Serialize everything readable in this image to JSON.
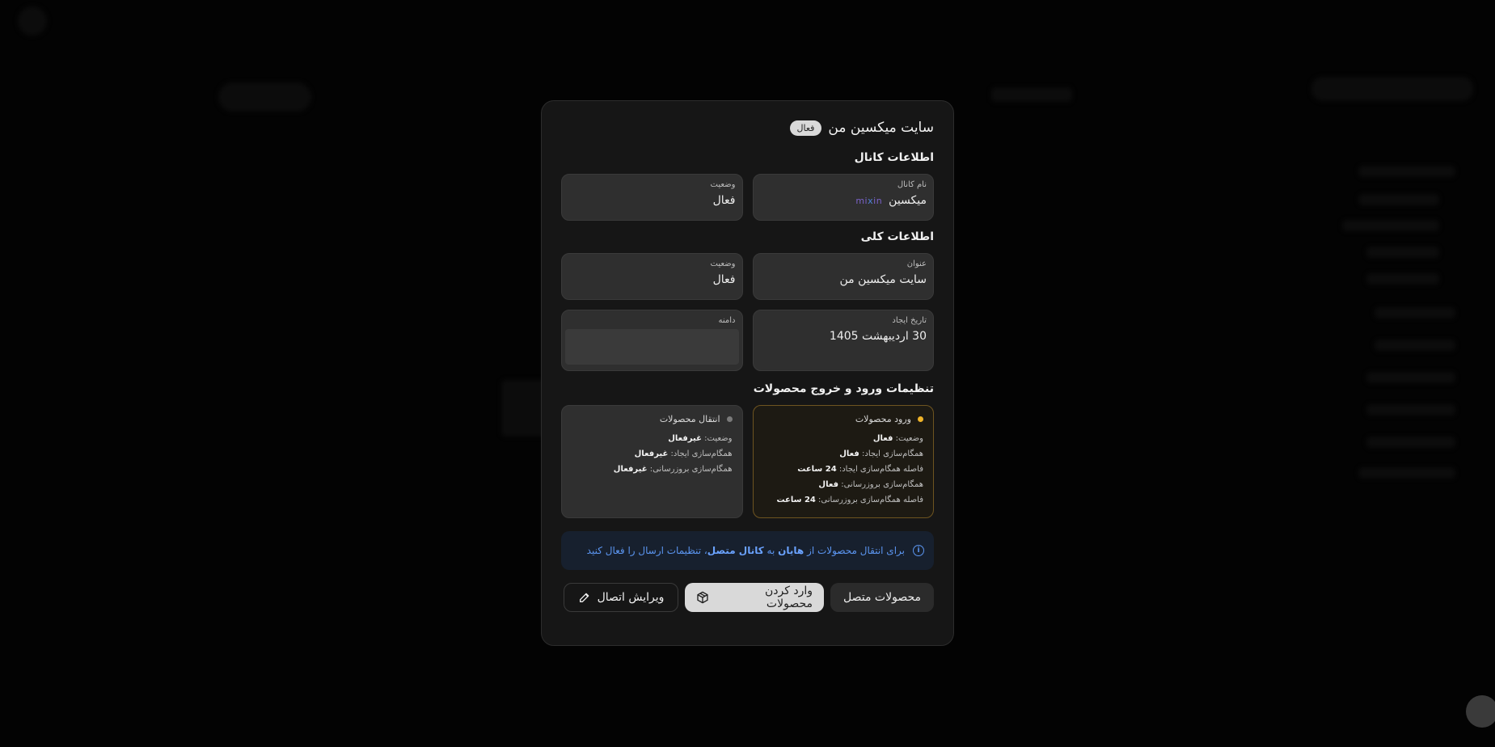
{
  "modal": {
    "title": "سایت میکسین من",
    "status_badge": "فعال"
  },
  "channel_info": {
    "section_title": "اطلاعات کانال",
    "channel_name": {
      "label": "نام کانال",
      "value": "میکسین",
      "logo_text": "mixin"
    },
    "status": {
      "label": "وضعیت",
      "value": "فعال"
    }
  },
  "general_info": {
    "section_title": "اطلاعات کلی",
    "title": {
      "label": "عنوان",
      "value": "سایت میکسین من"
    },
    "status": {
      "label": "وضعیت",
      "value": "فعال"
    },
    "created_at": {
      "label": "تاریخ ایجاد",
      "value": "30 اردیبهشت 1405"
    },
    "domain": {
      "label": "دامنه",
      "value": ""
    }
  },
  "products_settings": {
    "section_title": "تنظیمات ورود و خروج محصولات",
    "import_card": {
      "title": "ورود محصولات",
      "rows": [
        {
          "label": "وضعیت:",
          "value": "فعال"
        },
        {
          "label": "همگام‌سازی ایجاد:",
          "value": "فعال"
        },
        {
          "label": "فاصله همگام‌سازی ایجاد:",
          "value": "24 ساعت"
        },
        {
          "label": "همگام‌سازی بروزرسانی:",
          "value": "فعال"
        },
        {
          "label": "فاصله همگام‌سازی بروزرسانی:",
          "value": "24 ساعت"
        }
      ]
    },
    "transfer_card": {
      "title": "انتقال محصولات",
      "rows": [
        {
          "label": "وضعیت:",
          "value": "غیرفعال"
        },
        {
          "label": "همگام‌سازی ایجاد:",
          "value": "غیرفعال"
        },
        {
          "label": "همگام‌سازی بروزرسانی:",
          "value": "غیرفعال"
        }
      ]
    }
  },
  "info_notice": {
    "part1": "برای انتقال محصولات از",
    "strong1": "هایان",
    "part2": "به",
    "strong2": "کانال متصل",
    "part3": "، تنظیمات ارسال را فعال کنید"
  },
  "actions": {
    "connected_products": "محصولات متصل",
    "import_products": "وارد کردن محصولات",
    "edit_connection": "ویرایش اتصال"
  },
  "colors": {
    "import_dot": "#f0b429",
    "transfer_dot": "#7a7a7a",
    "info_text": "#5b95f0"
  }
}
